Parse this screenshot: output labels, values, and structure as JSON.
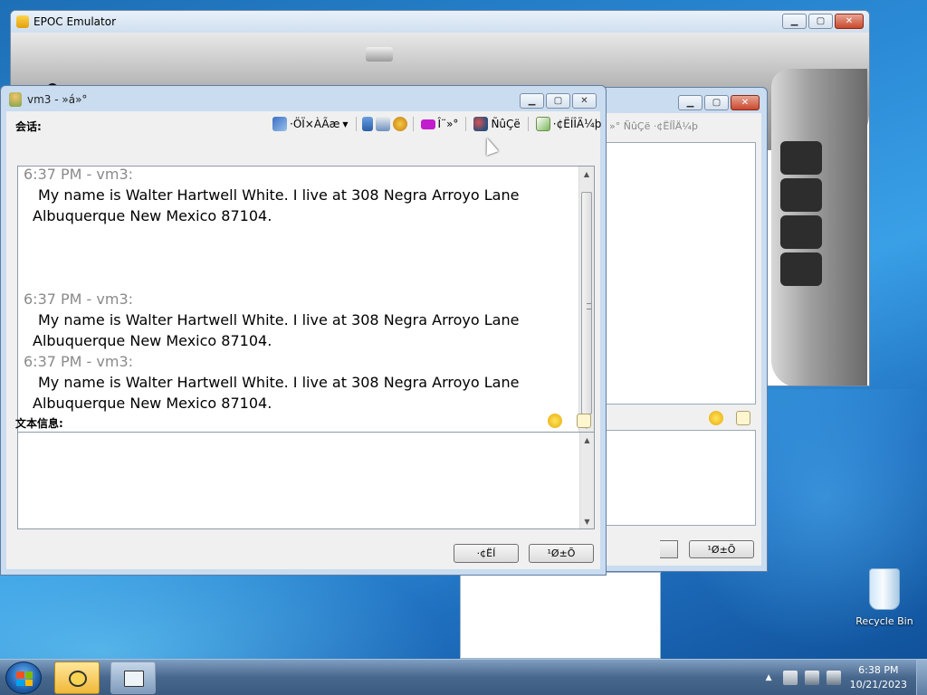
{
  "desktop": {
    "recycle_bin_label": "Recycle Bin"
  },
  "epoc_window": {
    "title": "EPOC Emulator"
  },
  "chat_window": {
    "title": "vm3 - »á»°",
    "conversation_label": "会话:",
    "toolbar": {
      "font_label": "·ÖÏ×ÀÃæ",
      "video_label": "Î¨»°",
      "invite_label": "ÑûÇë",
      "send_file_label": "·¢ËÍÎÄ¼þ"
    },
    "messages": [
      {
        "header": "6:37 PM - vm3:",
        "line1": "My name is Walter Hartwell White. I live at 308 Negra Arroyo Lane",
        "line2": "Albuquerque New Mexico 87104."
      },
      {
        "header": "6:37 PM - vm3:",
        "line1": "My name is Walter Hartwell White. I live at 308 Negra Arroyo Lane",
        "line2": "Albuquerque New Mexico 87104."
      },
      {
        "header": "6:37 PM - vm3:",
        "line1": "My name is Walter Hartwell White. I live at 308 Negra Arroyo Lane",
        "line2": "Albuquerque New Mexico 87104."
      }
    ],
    "text_info_label": "文本信息:",
    "input_value": "",
    "send_button": "·¢ËÍ",
    "close_button": "¹Ø±Õ"
  },
  "chat_window_2": {
    "toolbar_text": "»°  ÑûÇë  ·¢ËÍÎÄ¼þ",
    "close_button": "¹Ø±Õ"
  },
  "taskbar": {
    "clock_time": "6:38 PM",
    "clock_date": "10/21/2023"
  }
}
